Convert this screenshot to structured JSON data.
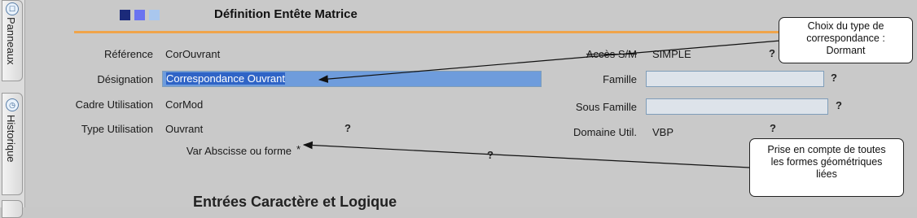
{
  "side_tabs": [
    {
      "label": "Panneaux",
      "icon": "panel-icon"
    },
    {
      "label": "Historique",
      "icon": "history-icon"
    }
  ],
  "header": {
    "title": "Définition Entête Matrice",
    "square_colors": [
      "#1b2a7a",
      "#6a73f0",
      "#a9c7ee"
    ],
    "accent_line_color": "#f0a44a"
  },
  "fields": {
    "reference": {
      "label": "Référence",
      "value": "CorOuvrant"
    },
    "designation": {
      "label": "Désignation",
      "value": "Correspondance Ouvrant"
    },
    "cadre": {
      "label": "Cadre Utilisation",
      "value": "CorMod"
    },
    "type": {
      "label": "Type Utilisation",
      "value": "Ouvrant",
      "help": "?"
    },
    "var_abscisse": {
      "label": "Var Abscisse ou forme",
      "value": "*",
      "help": "?"
    },
    "acces": {
      "label": "Accès S/M",
      "value": "SIMPLE",
      "help": "?"
    },
    "famille": {
      "label": "Famille",
      "value": "",
      "help": "?"
    },
    "sous_famille": {
      "label": "Sous Famille",
      "value": "",
      "help": "?"
    },
    "domaine": {
      "label": "Domaine Util.",
      "value": "VBP",
      "help": "?"
    }
  },
  "callouts": {
    "top": [
      "Choix du type de",
      "correspondance :",
      "Dormant"
    ],
    "bottom": [
      "Prise en compte de toutes",
      "les formes géométriques",
      "liées"
    ]
  },
  "section_title": "Entrées Caractère et Logique"
}
